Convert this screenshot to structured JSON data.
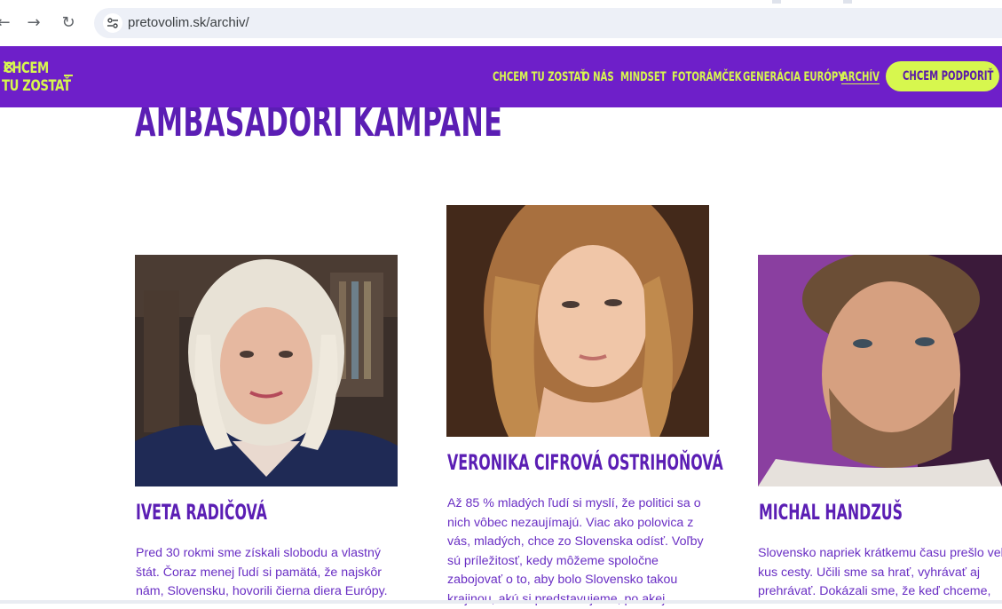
{
  "browser": {
    "url": "pretovolim.sk/archiv/",
    "back_icon": "back-arrow-icon",
    "forward_icon": "forward-arrow-icon",
    "reload_icon": "reload-icon",
    "site_info_icon": "tune-icon"
  },
  "site": {
    "logo_line1": "CHCEM",
    "logo_line2": "TU ZOSTAŤ",
    "brand_colors": {
      "purple": "#6e1fc9",
      "lime": "#d7f74e",
      "heading": "#5b1eb4"
    },
    "menu": [
      {
        "label": "CHCEM TU ZOSTAŤ"
      },
      {
        "label": "O NÁS"
      },
      {
        "label": "MINDSET"
      },
      {
        "label": "FOTORÁMČEK"
      },
      {
        "label": "GENERÁCIA EURÓPY"
      },
      {
        "label": "ARCHÍV",
        "active": true
      }
    ],
    "cta_label": "CHCEM PODPORIŤ"
  },
  "content": {
    "page_title": "AMBASADORI KAMPANE",
    "ambassadors": [
      {
        "name": "IVETA RADIČOVÁ",
        "lines": [
          "Pred 30 rokmi sme získali slobodu a vlastný",
          "štát. Čoraz menej ľudí si pamätá, že najskôr",
          "nám, Slovensku, hovorili čierna diera Európy."
        ]
      },
      {
        "name": "VERONIKA CIFROVÁ OSTRIHOŇOVÁ",
        "lines": [
          "Až 85 % mladých ľudí si myslí, že politici sa o",
          "nich vôbec nezaujímajú. Viac ako polovica z",
          "vás, mladých, chce zo Slovenska odísť. Voľby",
          "sú príležitosť, kedy môžeme spoločne",
          "zabojovať o to, aby bolo Slovensko takou",
          "krajinou, akú si predstavujeme, po akej"
        ]
      },
      {
        "name": "MICHAL HANDZUŠ",
        "lines": [
          "Slovensko napriek krátkemu času prešlo veľký",
          "kus cesty. Učili sme sa hrať, vyhrávať aj",
          "prehrávať. Dokázali sme, že keď chceme,"
        ]
      }
    ]
  }
}
